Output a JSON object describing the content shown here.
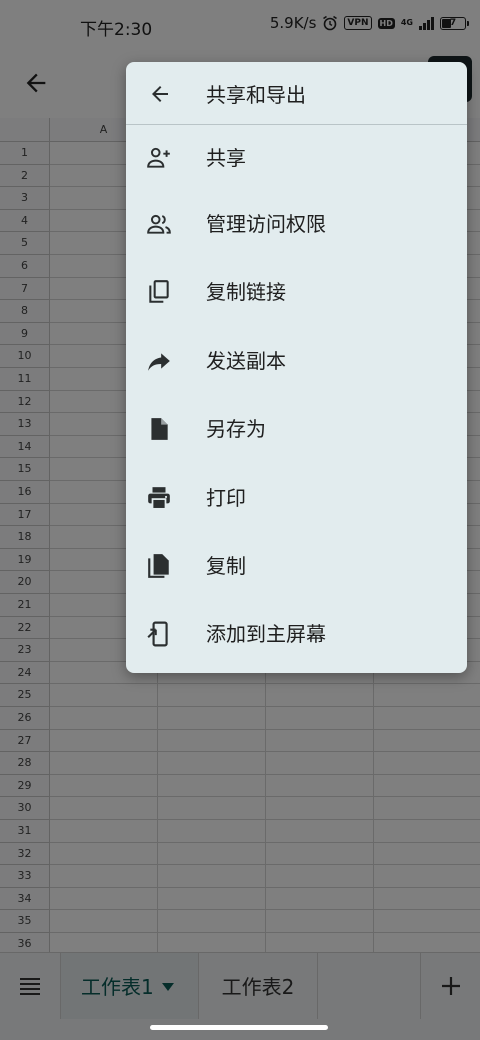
{
  "status_bar": {
    "time": "下午2:30",
    "speed": "5.9K/s",
    "vpn_label": "VPN",
    "hd_label": "HD",
    "network": "4G",
    "battery": "7"
  },
  "sheet": {
    "column_headers": [
      "A",
      "",
      "",
      ""
    ],
    "row_numbers": [
      "1",
      "2",
      "3",
      "4",
      "5",
      "6",
      "7",
      "8",
      "9",
      "10",
      "11",
      "12",
      "13",
      "14",
      "15",
      "16",
      "17",
      "18",
      "19",
      "20",
      "21",
      "22",
      "23",
      "24",
      "25",
      "26",
      "27",
      "28",
      "29",
      "30",
      "31",
      "32",
      "33",
      "34",
      "35",
      "36"
    ]
  },
  "menu": {
    "title": "共享和导出",
    "title_icon": "arrow-left-icon",
    "items": [
      {
        "label": "共享",
        "icon": "person-add-icon"
      },
      {
        "label": "管理访问权限",
        "icon": "people-icon"
      },
      {
        "label": "复制链接",
        "icon": "copy-icon"
      },
      {
        "label": "发送副本",
        "icon": "forward-arrow-icon"
      },
      {
        "label": "另存为",
        "icon": "file-icon"
      },
      {
        "label": "打印",
        "icon": "print-icon"
      },
      {
        "label": "复制",
        "icon": "file-copy-icon"
      },
      {
        "label": "添加到主屏幕",
        "icon": "add-to-home-icon"
      }
    ]
  },
  "tabs": {
    "items": [
      {
        "label": "工作表1",
        "selected": true
      },
      {
        "label": "工作表2",
        "selected": false
      }
    ]
  },
  "colors": {
    "menu_bg": "#e2ecee",
    "active_tab_text": "#0b5a55",
    "scrim": "rgba(0,0,0,0.5)"
  }
}
